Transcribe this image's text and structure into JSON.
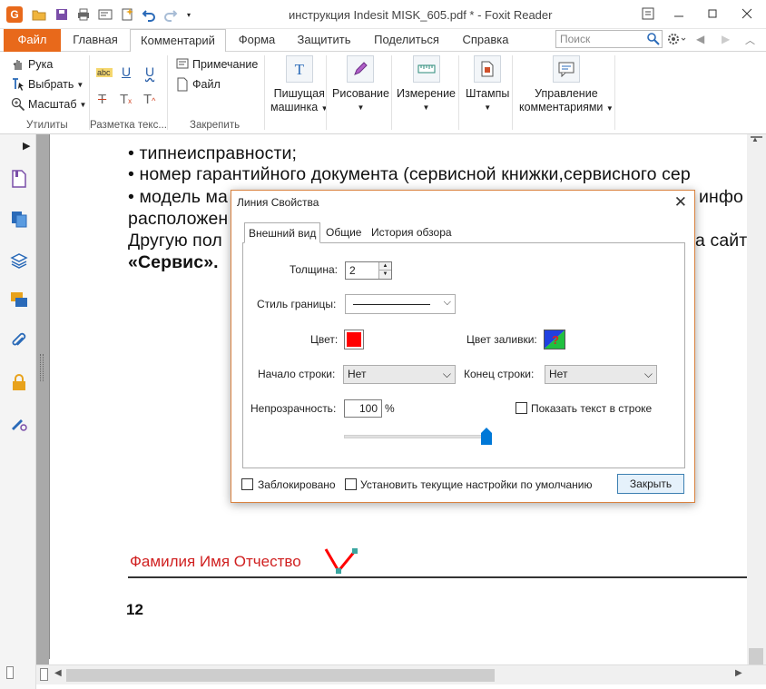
{
  "window": {
    "title": "инструкция Indesit MISK_605.pdf * - Foxit Reader",
    "app_icon": "foxit-logo",
    "minimize_icon": "minimize-icon",
    "maximize_icon": "maximize-icon",
    "close_icon": "close-icon"
  },
  "quick_access": [
    "open-folder-icon",
    "save-icon",
    "print-icon",
    "email-icon",
    "new-icon",
    "undo-icon",
    "redo-icon",
    "customize-dropdown-icon"
  ],
  "ribbon_tabs": {
    "file": "Файл",
    "home": "Главная",
    "comment": "Комментарий",
    "form": "Форма",
    "protect": "Защитить",
    "share": "Поделиться",
    "help": "Справка"
  },
  "search": {
    "placeholder": "Поиск"
  },
  "ribbon": {
    "tools": {
      "hand": "Рука",
      "select": "Выбрать",
      "zoom": "Масштаб",
      "group_label": "Утилиты"
    },
    "markup": {
      "group_label": "Разметка текс..."
    },
    "pin": {
      "note": "Примечание",
      "file": "Файл",
      "group_label": "Закрепить"
    },
    "typewriter": {
      "line1": "Пишущая",
      "line2": "машинка"
    },
    "drawing": "Рисование",
    "measure": "Измерение",
    "stamps": "Штампы",
    "manage": {
      "line1": "Управление",
      "line2": "комментариями"
    }
  },
  "document": {
    "lines": [
      "•  типнеисправности;",
      "•  номер гарантийного документа (сервисной книжки,сервисного сер",
      "•  модель ма",
      "расположен",
      "Другую пол",
      "«Сервис»."
    ],
    "right_fragments": {
      "r1": "инфо",
      "r2": "а сайте"
    },
    "signature_text": "Фамилия Имя Отчество",
    "page_number": "12"
  },
  "dialog": {
    "title": "Линия Свойства",
    "tabs": [
      "Внешний вид",
      "Общие",
      "История обзора"
    ],
    "thickness_label": "Толщина:",
    "thickness_value": "2",
    "border_style_label": "Стиль границы:",
    "color_label": "Цвет:",
    "color_value": "#ff0000",
    "fill_color_label": "Цвет заливки:",
    "line_start_label": "Начало строки:",
    "line_start_value": "Нет",
    "line_end_label": "Конец строки:",
    "line_end_value": "Нет",
    "opacity_label": "Непрозрачность:",
    "opacity_value": "100",
    "opacity_unit": "%",
    "opacity_level": 1.0,
    "show_text_label": "Показать текст в строке",
    "locked_label": "Заблокировано",
    "set_default_label": "Установить текущие настройки по умолчанию",
    "close_button": "Закрыть"
  },
  "colors": {
    "file_tab": "#e8691b",
    "accent_blue": "#3c7fb1",
    "signature_red": "#d02020",
    "stroke_red": "#ff0000"
  }
}
